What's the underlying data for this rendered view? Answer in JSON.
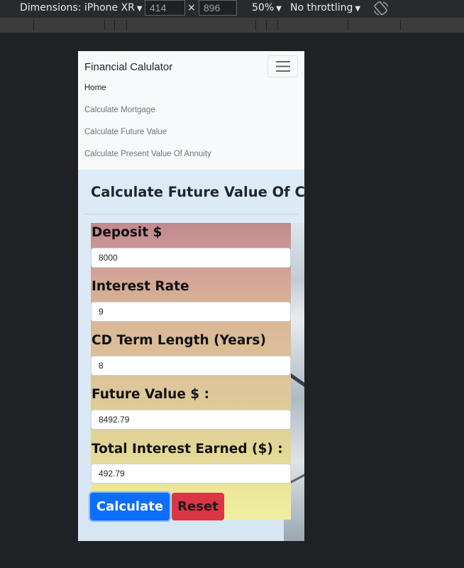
{
  "devtools": {
    "dimensions": "Dimensions: iPhone XR",
    "width": "414",
    "times": "×",
    "height": "896",
    "zoom": "50%",
    "throttle": "No throttling"
  },
  "app": {
    "brand": "Financial Calulator",
    "nav": [
      {
        "label": "Home",
        "active": true
      },
      {
        "label": "Calculate Mortgage",
        "active": false
      },
      {
        "label": "Calculate Future Value",
        "active": false
      },
      {
        "label": "Calculate Present Value Of Annuity",
        "active": false
      }
    ]
  },
  "page": {
    "title": "Calculate Future Value Of CD"
  },
  "form": {
    "fields": [
      {
        "label": "Deposit $",
        "value": "8000"
      },
      {
        "label": "Interest Rate",
        "value": "9"
      },
      {
        "label": "CD Term Length (Years)",
        "value": "8"
      },
      {
        "label": "Future Value $ :",
        "value": "8492.79"
      },
      {
        "label": "Total Interest Earned ($) :",
        "value": "492.79"
      }
    ],
    "calculate_label": "Calculate",
    "reset_label": "Reset"
  },
  "colors": {
    "primary": "#0d6efd",
    "danger": "#dc3545"
  }
}
